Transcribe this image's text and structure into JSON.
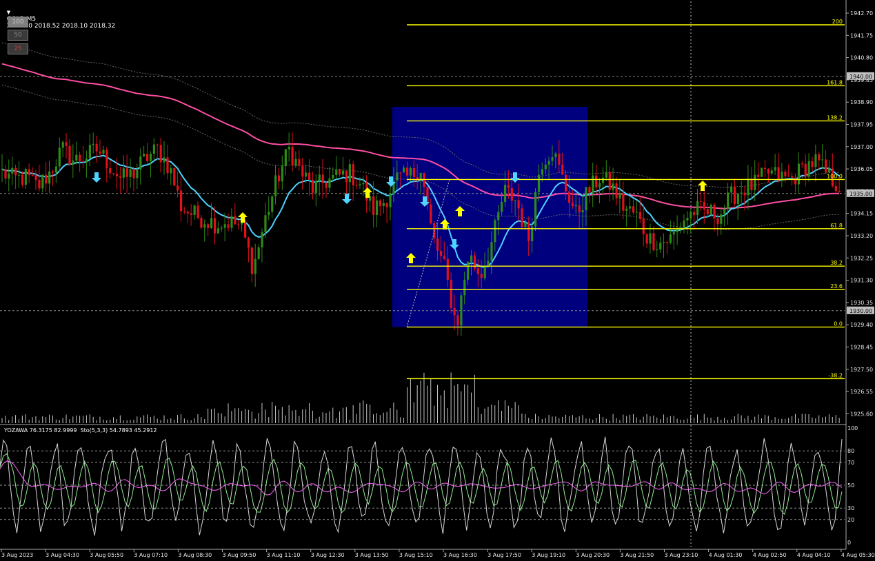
{
  "header": {
    "symbol_tf": "GOLD,M5",
    "ohlc": "2018.30 2018.52 2018.10 2018.32"
  },
  "zoom_buttons": [
    {
      "label": "100",
      "color": "#7f7f7f",
      "text": "#c8c8c8"
    },
    {
      "label": "50",
      "color": "#3a3a3a",
      "text": "#8a8a8a"
    },
    {
      "label": "25",
      "color": "#3a3a3a",
      "text": "#c84040"
    }
  ],
  "osc_header": "YOZAWA 76.3175 82.9999  Sto(5,3,3) 54.7893 45.2912",
  "colors": {
    "bull": "#2e8b17",
    "bear": "#e0111b",
    "ema": "#4fd3ff",
    "ma": "#ff4fa3",
    "fib": "#ffff00",
    "box": "#00007f",
    "up_arrow": "#ffff00",
    "down_arrow": "#4fd3ff",
    "volume": "#c8c8c8"
  },
  "icons": {
    "up": "up-arrow-icon",
    "down": "down-arrow-icon"
  },
  "chart_data": [
    {
      "type": "bar",
      "title": "GOLD,M5",
      "y_ticks": [
        "1942.70",
        "1941.75",
        "1940.80",
        "1939.85",
        "1938.90",
        "1937.95",
        "1937.00",
        "1936.05",
        "1935.10",
        "1934.15",
        "1933.20",
        "1932.25",
        "1931.30",
        "1930.35",
        "1929.40",
        "1928.45",
        "1927.50",
        "1926.55",
        "1925.60"
      ],
      "ylim": [
        1925.2,
        1943.2
      ],
      "marked_prices": [
        "1940.00",
        "1935.00",
        "1930.00"
      ],
      "x_ticks": [
        "3 Aug 2023",
        "3 Aug 04:30",
        "3 Aug 05:50",
        "3 Aug 07:10",
        "3 Aug 08:30",
        "3 Aug 09:50",
        "3 Aug 11:10",
        "3 Aug 12:30",
        "3 Aug 13:50",
        "3 Aug 15:10",
        "3 Aug 16:30",
        "3 Aug 17:50",
        "3 Aug 19:10",
        "3 Aug 20:30",
        "3 Aug 21:50",
        "3 Aug 23:10",
        "4 Aug 01:30",
        "4 Aug 02:50",
        "4 Aug 04:10",
        "4 Aug 05:30"
      ],
      "fib_levels": [
        {
          "label": "200",
          "price": 1942.2
        },
        {
          "label": "161.8",
          "price": 1939.6
        },
        {
          "label": "138.2",
          "price": 1938.1
        },
        {
          "label": "100.0",
          "price": 1935.6
        },
        {
          "label": "61.8",
          "price": 1933.5
        },
        {
          "label": "38.2",
          "price": 1931.9
        },
        {
          "label": "23.6",
          "price": 1930.9
        },
        {
          "label": "0.0",
          "price": 1929.3
        },
        {
          "label": "-38.2",
          "price": 1927.1
        }
      ],
      "close_path": [
        1935.9,
        1935.6,
        1935.7,
        1935.3,
        1935.9,
        1936.9,
        1936.4,
        1936.6,
        1936.9,
        1936.2,
        1935.6,
        1935.9,
        1936.5,
        1936.9,
        1936.1,
        1934.4,
        1934.1,
        1933.9,
        1933.7,
        1933.8,
        1933.6,
        1931.8,
        1933.9,
        1935.6,
        1936.9,
        1935.9,
        1935.2,
        1935.5,
        1935.7,
        1935.9,
        1935.4,
        1934.3,
        1934.7,
        1935.6,
        1935.7,
        1936.1,
        1933.1,
        1931.8,
        1929.3,
        1932.4,
        1931.5,
        1933.0,
        1935.1,
        1934.7,
        1933.0,
        1936.3,
        1936.9,
        1935.4,
        1934.1,
        1935.1,
        1935.7,
        1935.3,
        1934.4,
        1934.1,
        1933.1,
        1932.9,
        1933.1,
        1933.9,
        1934.3,
        1934.2,
        1934.1,
        1934.9,
        1935.2,
        1935.4,
        1935.9,
        1935.7,
        1935.6,
        1936.1,
        1936.4,
        1935.8,
        1935.3
      ]
    },
    {
      "type": "line",
      "title": "Sto(5,3,3)",
      "y_ticks": [
        "100",
        "80",
        "70",
        "50",
        "30",
        "20",
        "0"
      ],
      "ylim": [
        0,
        100
      ]
    }
  ]
}
